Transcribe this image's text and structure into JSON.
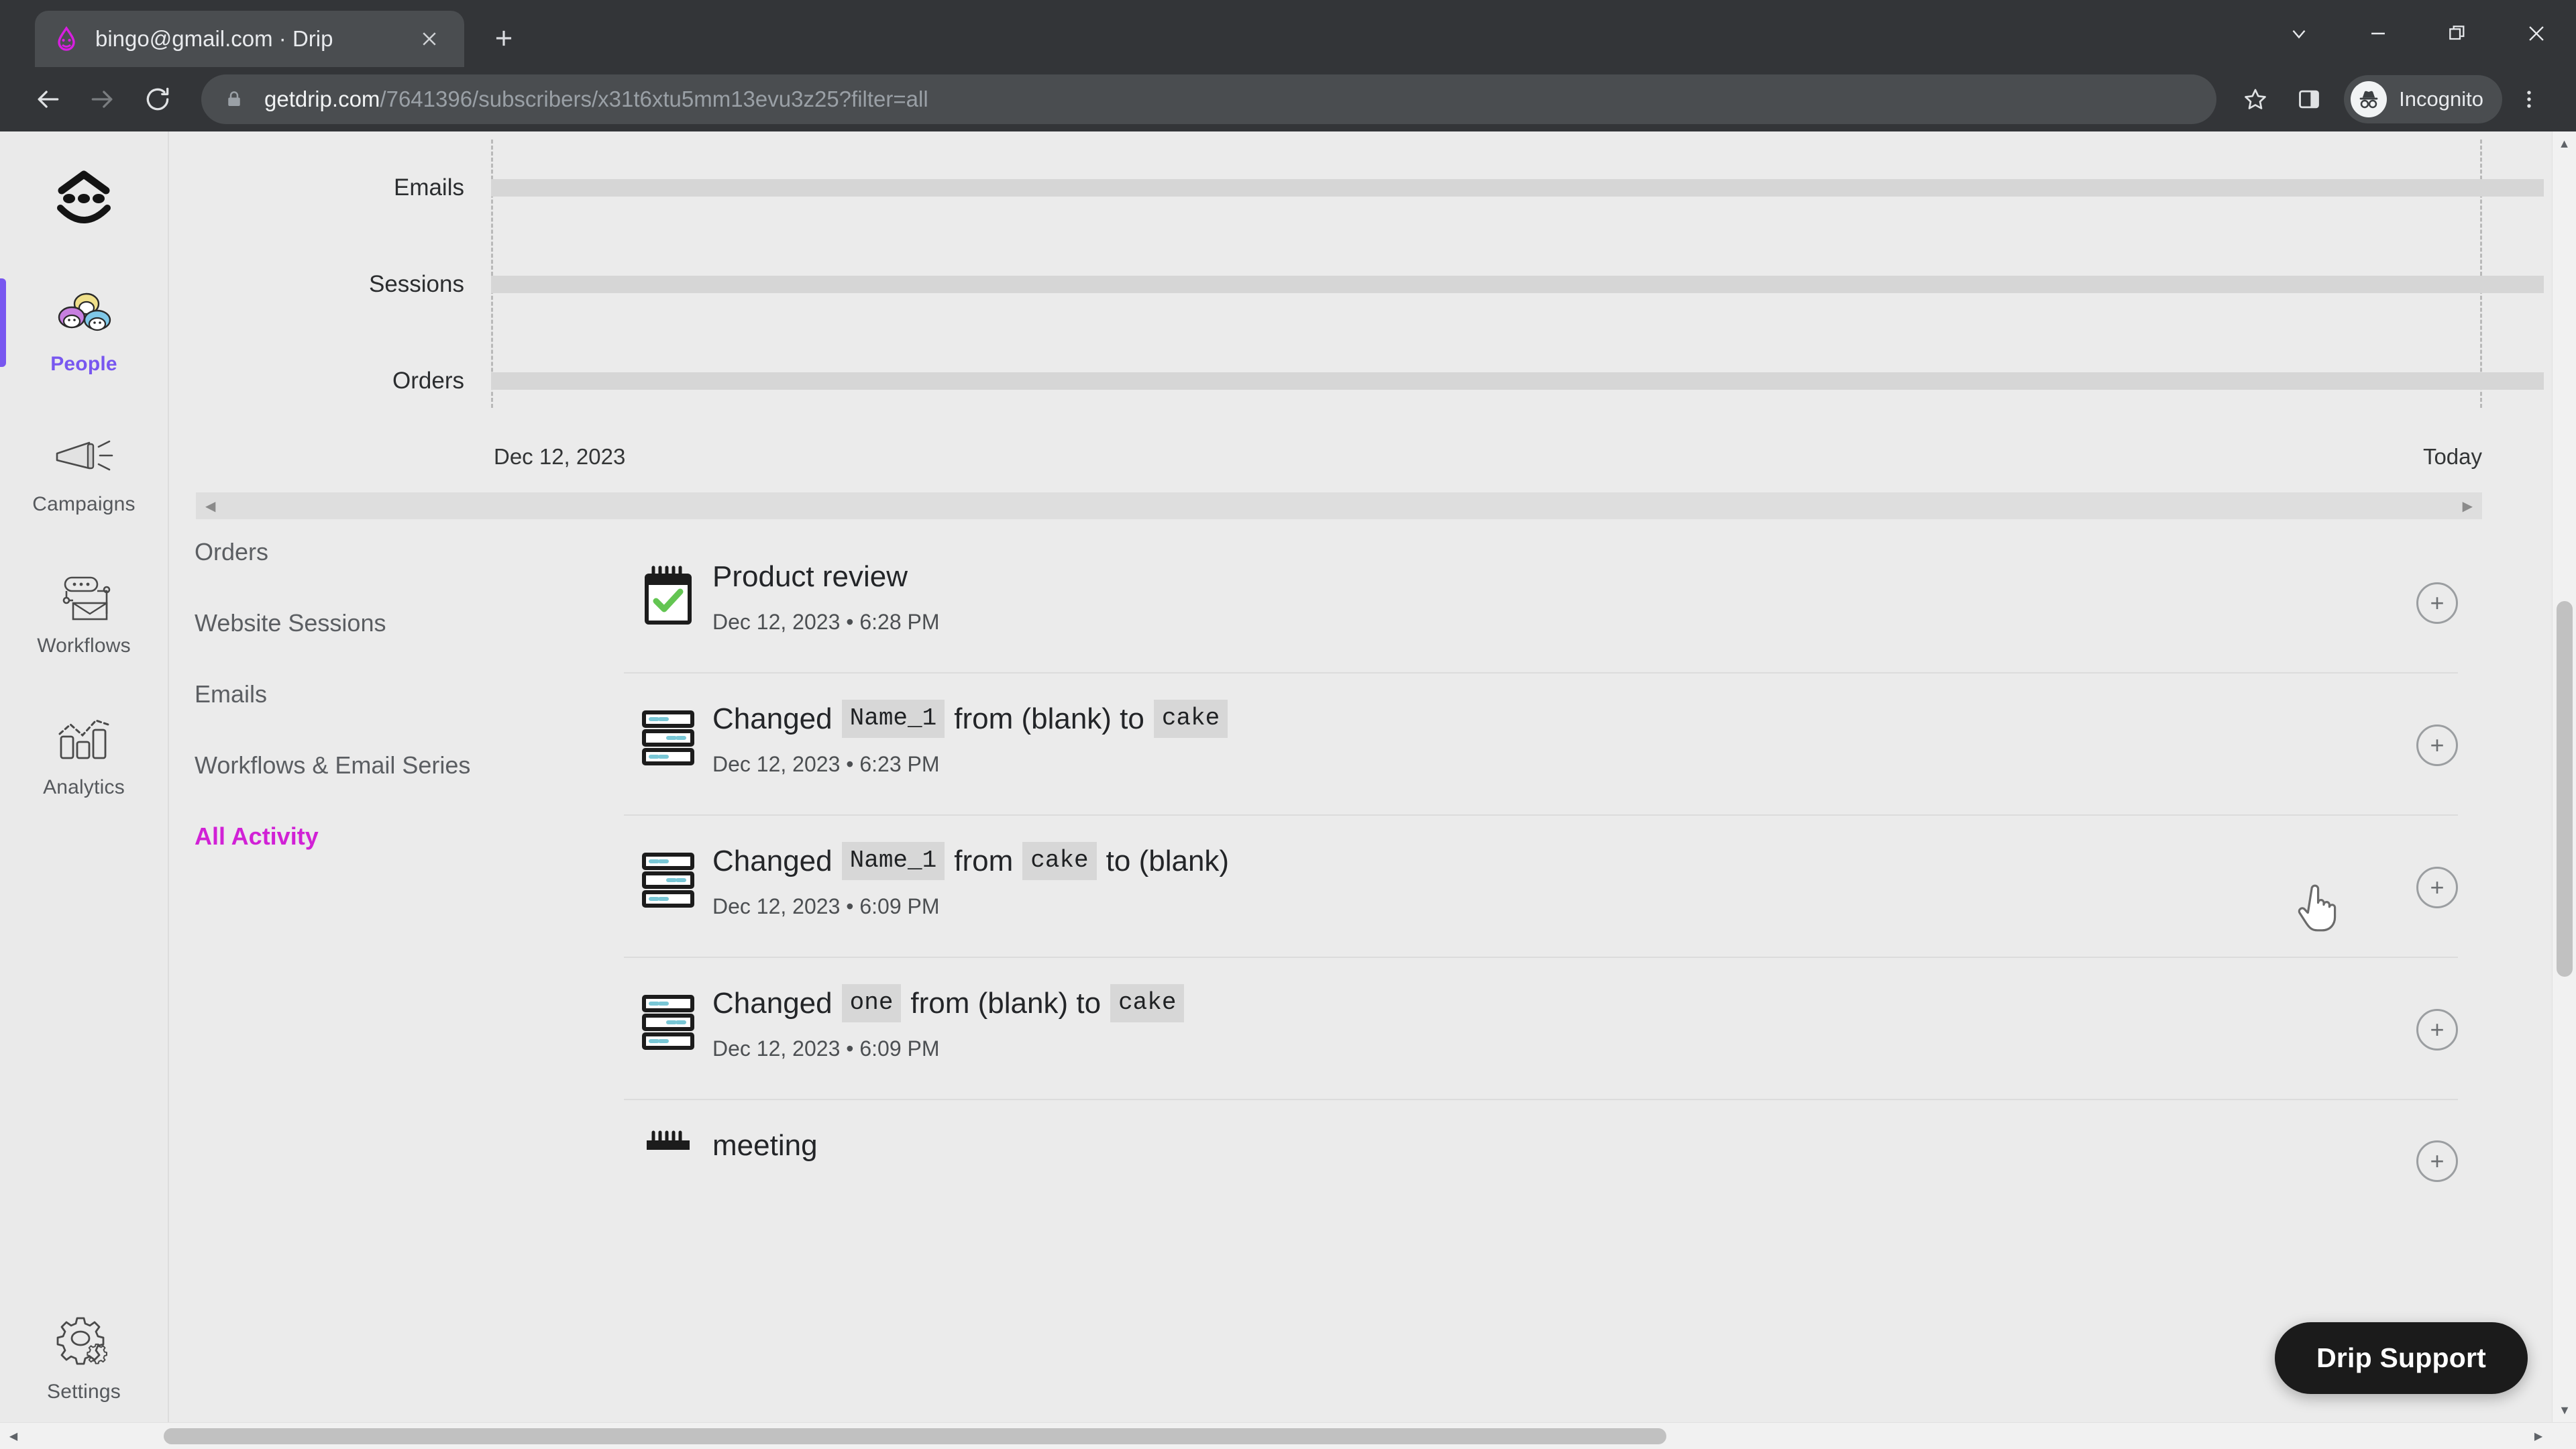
{
  "browser": {
    "tab": {
      "title": "bingo@gmail.com · Drip",
      "favicon_icon": "drip-logo-icon",
      "close_icon": "close-icon"
    },
    "new_tab_icon": "new-tab-plus-icon",
    "window_controls": [
      {
        "name": "tab-search",
        "icon": "chevron-down-icon"
      },
      {
        "name": "minimize",
        "icon": "minimize-icon"
      },
      {
        "name": "restore",
        "icon": "restore-window-icon"
      },
      {
        "name": "close",
        "icon": "close-window-icon"
      }
    ],
    "toolbar": {
      "back_icon": "back-arrow-icon",
      "forward_icon": "forward-arrow-icon",
      "reload_icon": "reload-icon",
      "lock_icon": "lock-icon",
      "url_host": "getdrip.com",
      "url_path": "/7641396/subscribers/x31t6xtu5mm13evu3z25?filter=all",
      "url_full": "getdrip.com/7641396/subscribers/x31t6xtu5mm13evu3z25?filter=all",
      "bookmark_icon": "star-icon",
      "side_panel_icon": "side-panel-icon",
      "incognito_label": "Incognito",
      "incognito_icon": "incognito-hat-icon",
      "menu_icon": "three-dot-menu-icon"
    }
  },
  "rail": {
    "logo_icon": "drip-face-logo-icon",
    "items": [
      {
        "label": "People",
        "icon": "people-icon",
        "active": true
      },
      {
        "label": "Campaigns",
        "icon": "megaphone-icon",
        "active": false
      },
      {
        "label": "Workflows",
        "icon": "workflow-icon",
        "active": false
      },
      {
        "label": "Analytics",
        "icon": "bar-chart-icon",
        "active": false
      }
    ],
    "bottom_item": {
      "label": "Settings",
      "icon": "gear-icon",
      "active": false
    },
    "active_color": "#7857f0"
  },
  "chart_data": {
    "type": "timeline",
    "title": "",
    "categories": [
      "Emails",
      "Sessions",
      "Orders"
    ],
    "values": [
      0,
      0,
      0
    ],
    "x_ticks": [
      "Dec 12, 2023",
      "Today"
    ],
    "xlabel": "",
    "ylabel": "",
    "grid": false,
    "legend": "none",
    "notes": "Three empty horizontal activity tracks spanning Dec 12, 2023 to Today; dashed vertical boundary lines at both ends.",
    "scrollbar": {
      "left_arrow_icon": "left-arrow-icon",
      "right_arrow_icon": "right-arrow-icon"
    }
  },
  "activity": {
    "nav": [
      {
        "label": "Orders",
        "active": false
      },
      {
        "label": "Website Sessions",
        "active": false
      },
      {
        "label": "Emails",
        "active": false
      },
      {
        "label": "Workflows & Email Series",
        "active": false
      },
      {
        "label": "All Activity",
        "active": true
      }
    ],
    "active_color": "#d121d6",
    "expand_icon": "plus-circle-icon",
    "rows": [
      {
        "icon": "spiral-notepad-check-icon",
        "parts": [
          {
            "type": "text",
            "value": "Product review"
          }
        ],
        "timestamp": "Dec 12, 2023 • 6:28 PM"
      },
      {
        "icon": "control-knobs-icon",
        "parts": [
          {
            "type": "text",
            "value": "Changed"
          },
          {
            "type": "chip",
            "value": "Name_1"
          },
          {
            "type": "text",
            "value": "from (blank) to"
          },
          {
            "type": "chip",
            "value": "cake"
          }
        ],
        "timestamp": "Dec 12, 2023 • 6:23 PM"
      },
      {
        "icon": "control-knobs-icon",
        "parts": [
          {
            "type": "text",
            "value": "Changed"
          },
          {
            "type": "chip",
            "value": "Name_1"
          },
          {
            "type": "text",
            "value": "from"
          },
          {
            "type": "chip",
            "value": "cake"
          },
          {
            "type": "text",
            "value": "to (blank)"
          }
        ],
        "timestamp": "Dec 12, 2023 • 6:09 PM"
      },
      {
        "icon": "control-knobs-icon",
        "parts": [
          {
            "type": "text",
            "value": "Changed"
          },
          {
            "type": "chip",
            "value": "one"
          },
          {
            "type": "text",
            "value": "from (blank) to"
          },
          {
            "type": "chip",
            "value": "cake"
          }
        ],
        "timestamp": "Dec 12, 2023 • 6:09 PM"
      },
      {
        "icon": "spiral-notepad-icon",
        "parts": [
          {
            "type": "text",
            "value": "meeting"
          }
        ],
        "timestamp": "",
        "partial": true
      }
    ]
  },
  "support": {
    "label": "Drip Support"
  },
  "scrollbars": {
    "vertical": {
      "up_icon": "scroll-up-arrow-icon",
      "down_icon": "scroll-down-arrow-icon"
    },
    "horizontal": {
      "left_icon": "scroll-left-arrow-icon",
      "right_icon": "scroll-right-arrow-icon"
    }
  }
}
